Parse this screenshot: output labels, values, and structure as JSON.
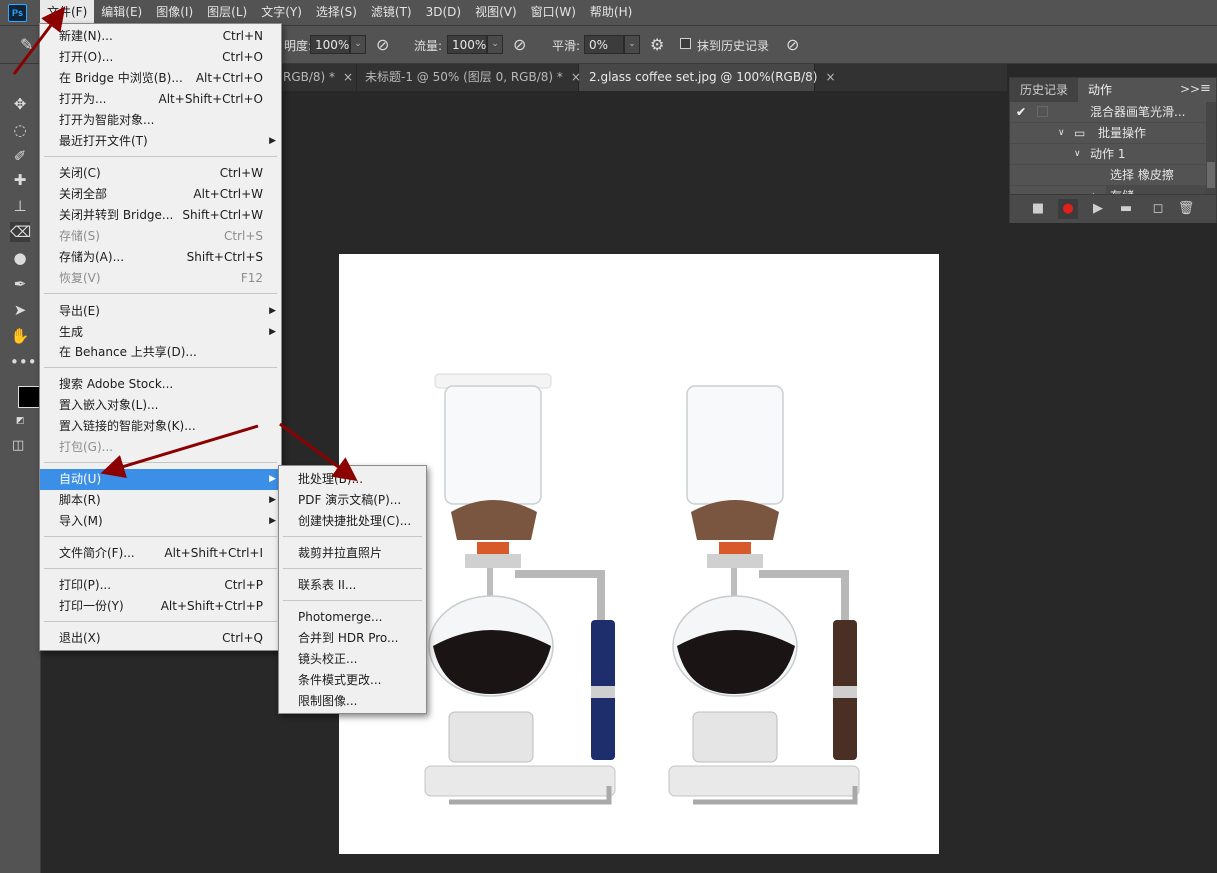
{
  "menubar": {
    "logo": "Ps",
    "items": [
      "文件(F)",
      "编辑(E)",
      "图像(I)",
      "图层(L)",
      "文字(Y)",
      "选择(S)",
      "滤镜(T)",
      "3D(D)",
      "视图(V)",
      "窗口(W)",
      "帮助(H)"
    ],
    "active_index": 0
  },
  "options": {
    "opacity_label": "明度:",
    "opacity_value": "100%",
    "flow_label": "流量:",
    "flow_value": "100%",
    "smooth_label": "平滑:",
    "smooth_value": "0%",
    "history_label": "抹到历史记录"
  },
  "tabs": [
    {
      "label": "RGB/8) *",
      "close": "×"
    },
    {
      "label": "未标题-1 @ 50% (图层 0, RGB/8) *",
      "close": "×"
    },
    {
      "label": "2.glass coffee set.jpg @ 100%(RGB/8)",
      "close": "×"
    }
  ],
  "file_menu": {
    "items": [
      {
        "label": "新建(N)...",
        "shortcut": "Ctrl+N"
      },
      {
        "label": "打开(O)...",
        "shortcut": "Ctrl+O"
      },
      {
        "label": "在 Bridge 中浏览(B)...",
        "shortcut": "Alt+Ctrl+O"
      },
      {
        "label": "打开为...",
        "shortcut": "Alt+Shift+Ctrl+O"
      },
      {
        "label": "打开为智能对象...",
        "shortcut": ""
      },
      {
        "label": "最近打开文件(T)",
        "shortcut": ""
      },
      {
        "label": "关闭(C)",
        "shortcut": "Ctrl+W"
      },
      {
        "label": "关闭全部",
        "shortcut": "Alt+Ctrl+W"
      },
      {
        "label": "关闭并转到 Bridge...",
        "shortcut": "Shift+Ctrl+W"
      },
      {
        "label": "存储(S)",
        "shortcut": "Ctrl+S"
      },
      {
        "label": "存储为(A)...",
        "shortcut": "Shift+Ctrl+S"
      },
      {
        "label": "恢复(V)",
        "shortcut": "F12"
      },
      {
        "label": "导出(E)",
        "shortcut": ""
      },
      {
        "label": "生成",
        "shortcut": ""
      },
      {
        "label": "在 Behance 上共享(D)...",
        "shortcut": ""
      },
      {
        "label": "搜索 Adobe Stock...",
        "shortcut": ""
      },
      {
        "label": "置入嵌入对象(L)...",
        "shortcut": ""
      },
      {
        "label": "置入链接的智能对象(K)...",
        "shortcut": ""
      },
      {
        "label": "打包(G)...",
        "shortcut": ""
      },
      {
        "label": "自动(U)",
        "shortcut": ""
      },
      {
        "label": "脚本(R)",
        "shortcut": ""
      },
      {
        "label": "导入(M)",
        "shortcut": ""
      },
      {
        "label": "文件简介(F)...",
        "shortcut": "Alt+Shift+Ctrl+I"
      },
      {
        "label": "打印(P)...",
        "shortcut": "Ctrl+P"
      },
      {
        "label": "打印一份(Y)",
        "shortcut": "Alt+Shift+Ctrl+P"
      },
      {
        "label": "退出(X)",
        "shortcut": "Ctrl+Q"
      }
    ]
  },
  "auto_submenu": {
    "items": [
      "批处理(B)...",
      "PDF 演示文稿(P)...",
      "创建快捷批处理(C)...",
      "裁剪并拉直照片",
      "联系表 II...",
      "Photomerge...",
      "合并到 HDR Pro...",
      "镜头校正...",
      "条件模式更改...",
      "限制图像..."
    ]
  },
  "panel": {
    "tabs": [
      "历史记录",
      "动作"
    ],
    "rows": [
      "混合器画笔光滑...",
      "批量操作",
      "动作 1",
      "选择 橡皮擦",
      "存储"
    ],
    "collapse": ">>"
  },
  "colors": {
    "highlight": "#3c8fe6",
    "arrow": "#8b0000",
    "record": "#e0201b"
  }
}
